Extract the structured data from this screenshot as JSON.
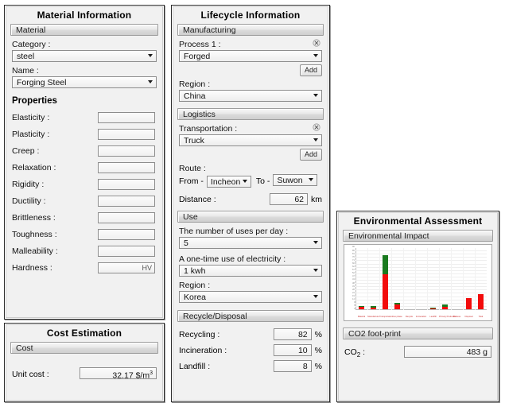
{
  "material_panel": {
    "title": "Material Information",
    "section_material": "Material",
    "category_label": "Category :",
    "category_value": "steel",
    "name_label": "Name :",
    "name_value": "Forging Steel",
    "properties_heading": "Properties",
    "properties": [
      {
        "label": "Elasticity :",
        "value": "",
        "unit": ""
      },
      {
        "label": "Plasticity :",
        "value": "",
        "unit": ""
      },
      {
        "label": "Creep :",
        "value": "",
        "unit": ""
      },
      {
        "label": "Relaxation :",
        "value": "",
        "unit": ""
      },
      {
        "label": "Rigidity :",
        "value": "",
        "unit": ""
      },
      {
        "label": "Ductility :",
        "value": "",
        "unit": ""
      },
      {
        "label": "Brittleness :",
        "value": "",
        "unit": ""
      },
      {
        "label": "Toughness :",
        "value": "",
        "unit": ""
      },
      {
        "label": "Malleability :",
        "value": "",
        "unit": ""
      },
      {
        "label": "Hardness :",
        "value": "HV",
        "unit": ""
      }
    ]
  },
  "cost_panel": {
    "title": "Cost Estimation",
    "section_cost": "Cost",
    "unit_cost_label": "Unit cost :",
    "unit_cost_value": "32.17 $/m",
    "unit_cost_sup": "3"
  },
  "lifecycle_panel": {
    "title": "Lifecycle Information",
    "manufacturing": {
      "section": "Manufacturing",
      "process_label": "Process 1 :",
      "process_value": "Forged",
      "add_label": "Add",
      "region_label": "Region :",
      "region_value": "China"
    },
    "logistics": {
      "section": "Logistics",
      "transportation_label": "Transportation :",
      "transportation_value": "Truck",
      "add_label": "Add",
      "route_label": "Route :",
      "from_label": "From -",
      "from_value": "Incheon",
      "to_label": "To -",
      "to_value": "Suwon",
      "distance_label": "Distance :",
      "distance_value": "62",
      "distance_unit": "km"
    },
    "use": {
      "section": "Use",
      "uses_label": "The number of uses per day :",
      "uses_value": "5",
      "electricity_label": "A one-time use of electricity :",
      "electricity_value": "1 kwh",
      "region_label": "Region :",
      "region_value": "Korea"
    },
    "recycle": {
      "section": "Recycle/Disposal",
      "recycling_label": "Recycling :",
      "recycling_value": "82",
      "incineration_label": "Incineration :",
      "incineration_value": "10",
      "landfill_label": "Landfill :",
      "landfill_value": "8",
      "percent": "%"
    }
  },
  "environment_panel": {
    "title": "Environmental Assessment",
    "section_impact": "Environmental Impact",
    "section_co2": "CO2 foot-print",
    "co2_label": "CO",
    "co2_sub": "2",
    "co2_colon": " :",
    "co2_value": "483 g"
  },
  "colors": {
    "bar_red": "#f20c0c",
    "bar_green": "#1a7a1f",
    "panel_bg": "#f1f1f1",
    "section_bar": "#dcdcdc"
  },
  "chart_data": {
    "type": "bar",
    "title": "Environmental Impact",
    "xlabel": "",
    "ylabel": "",
    "grid": true,
    "legend": "none",
    "stacked": true,
    "categories": [
      "Material",
      "Manufacture",
      "Transportation",
      "Use phase",
      "Recycle",
      "Incineration",
      "Landfill",
      "Primary Production",
      "Process",
      "Disposal",
      "Total"
    ],
    "series": [
      {
        "name": "red",
        "color": "#f20c0c",
        "values": [
          3,
          2,
          52,
          7,
          0,
          0,
          1.5,
          4,
          0,
          17,
          22
        ]
      },
      {
        "name": "green",
        "color": "#1a7a1f",
        "values": [
          1.5,
          3,
          28,
          2,
          0,
          0,
          0.5,
          3,
          0,
          0,
          0
        ]
      }
    ],
    "ylim": [
      0,
      90
    ]
  }
}
